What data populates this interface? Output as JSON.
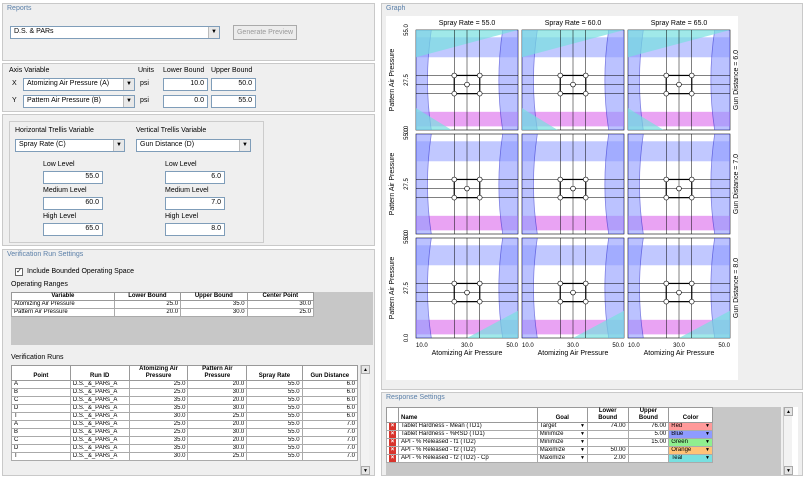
{
  "reports": {
    "title": "Reports",
    "selected": "D.S. & PARs",
    "generate_label": "Generate Preview"
  },
  "axis": {
    "header_variable": "Axis Variable",
    "header_units": "Units",
    "header_lower": "Lower Bound",
    "header_upper": "Upper Bound",
    "x_letter": "X",
    "x_variable": "Atomizing Air Pressure (A)",
    "x_units": "psi",
    "x_lower": "10.0",
    "x_upper": "50.0",
    "y_letter": "Y",
    "y_variable": "Pattern Air Pressure (B)",
    "y_units": "psi",
    "y_lower": "0.0",
    "y_upper": "55.0"
  },
  "trellis": {
    "h_label": "Horizontal Trellis Variable",
    "h_value": "Spray Rate (C)",
    "v_label": "Vertical Trellis Variable",
    "v_value": "Gun Distance (D)",
    "low_label": "Low Level",
    "medium_label": "Medium Level",
    "high_label": "High Level",
    "h_low": "55.0",
    "h_medium": "60.0",
    "h_high": "65.0",
    "v_low": "6.0",
    "v_medium": "7.0",
    "v_high": "8.0"
  },
  "verification": {
    "title": "Verification Run Settings",
    "include_label": "Include Bounded Operating Space",
    "ranges_label": "Operating Ranges",
    "ranges_headers": [
      "Variable",
      "Lower Bound",
      "Upper Bound",
      "Center Point"
    ],
    "ranges_rows": [
      [
        "Atomizing Air Pressure",
        "25.0",
        "35.0",
        "30.0"
      ],
      [
        "Pattern Air Pressure",
        "20.0",
        "30.0",
        "25.0"
      ]
    ],
    "runs_label": "Verification Runs",
    "runs_headers": [
      "Point",
      "Run ID",
      "Atomizing Air Pressure",
      "Pattern Air Pressure",
      "Spray Rate",
      "Gun Distance"
    ],
    "runs_rows": [
      [
        "A",
        "D.S._&_PARs_A",
        "25.0",
        "20.0",
        "55.0",
        "6.0"
      ],
      [
        "B",
        "D.S._&_PARs_A",
        "25.0",
        "30.0",
        "55.0",
        "6.0"
      ],
      [
        "C",
        "D.S._&_PARs_A",
        "35.0",
        "20.0",
        "55.0",
        "6.0"
      ],
      [
        "D",
        "D.S._&_PARs_A",
        "35.0",
        "30.0",
        "55.0",
        "6.0"
      ],
      [
        "T",
        "D.S._&_PARs_A",
        "30.0",
        "25.0",
        "55.0",
        "6.0"
      ],
      [
        "A",
        "D.S._&_PARs_A",
        "25.0",
        "20.0",
        "55.0",
        "7.0"
      ],
      [
        "B",
        "D.S._&_PARs_A",
        "25.0",
        "30.0",
        "55.0",
        "7.0"
      ],
      [
        "C",
        "D.S._&_PARs_A",
        "35.0",
        "20.0",
        "55.0",
        "7.0"
      ],
      [
        "D",
        "D.S._&_PARs_A",
        "35.0",
        "30.0",
        "55.0",
        "7.0"
      ],
      [
        "T",
        "D.S._&_PARs_A",
        "30.0",
        "25.0",
        "55.0",
        "7.0"
      ]
    ]
  },
  "graph": {
    "title": "Graph",
    "col_titles": [
      "Spray Rate = 55.0",
      "Spray Rate = 60.0",
      "Spray Rate = 65.0"
    ],
    "row_titles": [
      "Gun Distance = 6.0",
      "Gun Distance = 7.0",
      "Gun Distance = 8.0"
    ],
    "y_label": "Pattern Air Pressure",
    "x_label": "Atomizing Air Pressure",
    "y_ticks": [
      "0.0",
      "27.5",
      "55.0"
    ],
    "x_ticks": [
      "10.0",
      "30.0",
      "50.0"
    ]
  },
  "response": {
    "title": "Response Settings",
    "headers": [
      "Name",
      "Goal",
      "Lower Bound",
      "Upper Bound",
      "Color"
    ],
    "rows": [
      [
        "Tablet Hardness - Mean (TD1)",
        "Target",
        "74.00",
        "76.00",
        "Red",
        "#ff9a9a"
      ],
      [
        "Tablet Hardness - %RSD (TD1)",
        "Minimize",
        "",
        "5.00",
        "Blue",
        "#8e9bff"
      ],
      [
        "API - % Released - f1 (TD2)",
        "Minimize",
        "",
        "15.00",
        "Green",
        "#8fef8f"
      ],
      [
        "API - % Released - f2 (TD2)",
        "Maximize",
        "50.00",
        "",
        "Orange",
        "#ffc277"
      ],
      [
        "API - % Released - f2 (TD2) - Cp",
        "Maximize",
        "2.00",
        "",
        "Teal",
        "#78e0e0"
      ]
    ]
  }
}
